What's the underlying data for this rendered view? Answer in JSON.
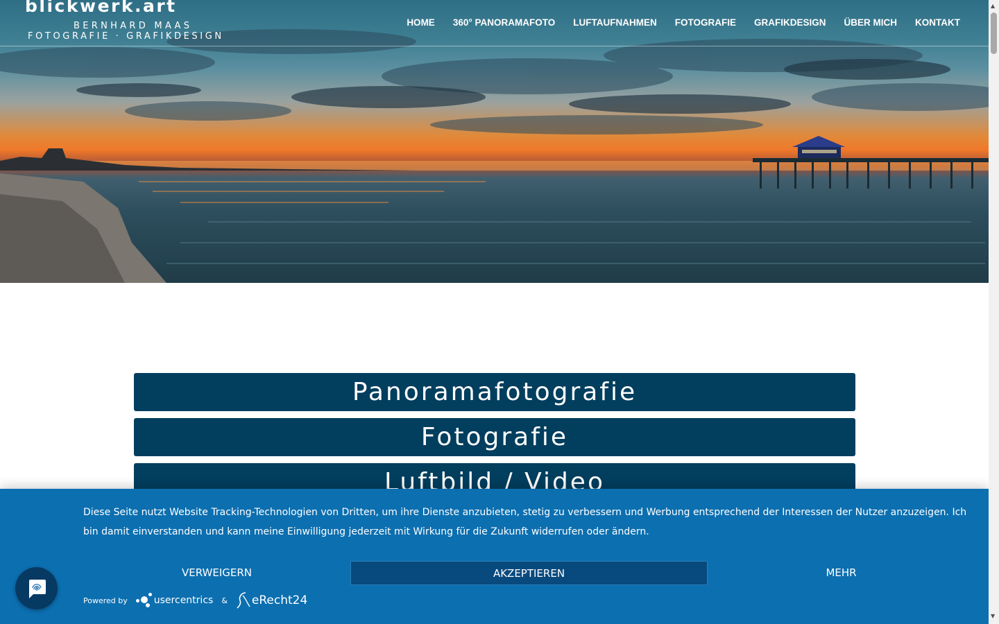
{
  "site": {
    "logo_title": "blickwerk.art",
    "logo_name": "BERNHARD MAAS",
    "logo_tagline": "FOTOGRAFIE · GRAFIKDESIGN"
  },
  "nav": {
    "items": [
      {
        "label": "HOME"
      },
      {
        "label": "360° PANORAMAFOTO"
      },
      {
        "label": "LUFTAUFNAHMEN"
      },
      {
        "label": "FOTOGRAFIE"
      },
      {
        "label": "GRAFIKDESIGN"
      },
      {
        "label": "ÜBER MICH"
      },
      {
        "label": "KONTAKT"
      }
    ]
  },
  "sections": [
    {
      "label": "Panoramafotografie"
    },
    {
      "label": "Fotografie"
    },
    {
      "label": "Luftbild / Video"
    }
  ],
  "cookie_banner": {
    "text": "Diese Seite nutzt Website Tracking-Technologien von Dritten, um ihre Dienste anzubieten, stetig zu verbessern und Werbung entsprechend der Interessen der Nutzer anzuzeigen. Ich bin damit einverstanden und kann meine Einwilligung jederzeit mit Wirkung für die Zukunft widerrufen oder ändern.",
    "deny_label": "VERWEIGERN",
    "accept_label": "AKZEPTIEREN",
    "more_label": "MEHR",
    "powered_by": "Powered by",
    "usercentrics": "usercentrics",
    "ampersand": "&",
    "erecht": "eRecht24"
  },
  "icons": {
    "privacy_fab": "fingerprint-chat-icon",
    "scroll_up": "triangle-up-icon",
    "scroll_down": "triangle-down-icon"
  },
  "colors": {
    "section_bg": "#023e5e",
    "cookie_bg": "#0c6fb0",
    "accept_bg": "#084a7e",
    "fab_bg": "#063a63"
  }
}
